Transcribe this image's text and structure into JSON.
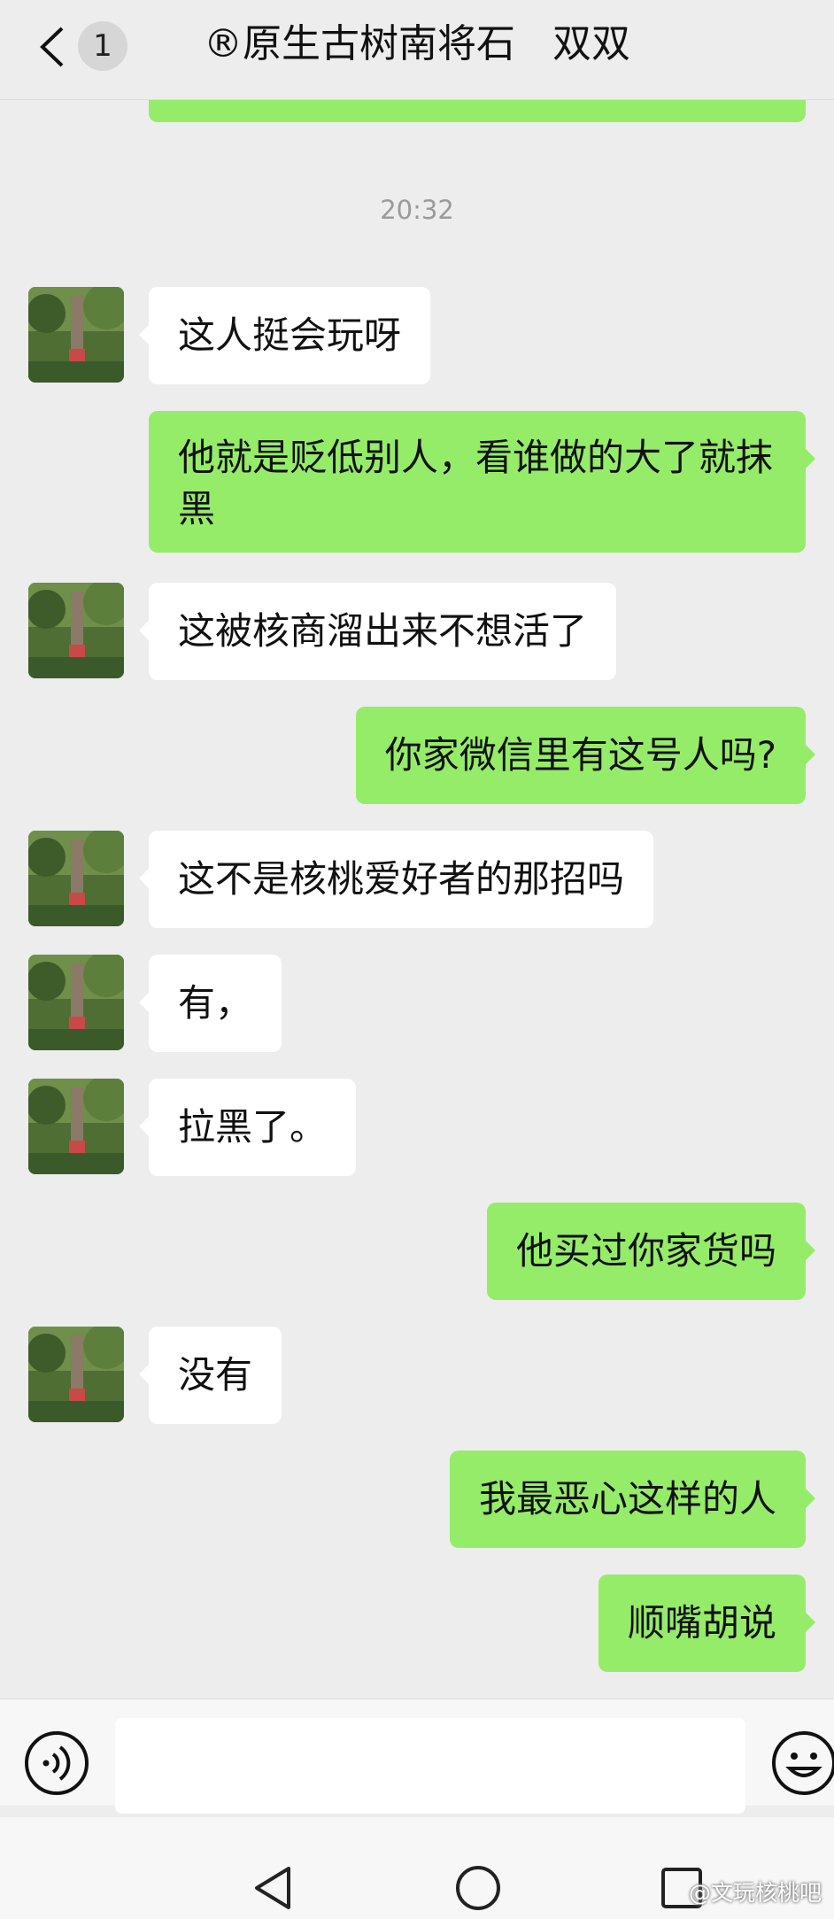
{
  "header": {
    "unread_count": "1",
    "title": "®原生古树南将石   双双"
  },
  "time_label": "20:32",
  "messages": [
    {
      "side": "in",
      "text": "这人挺会玩呀"
    },
    {
      "side": "out",
      "text": "他就是贬低别人，看谁做的大了就抹黑"
    },
    {
      "side": "in",
      "text": "这被核商溜出来不想活了"
    },
    {
      "side": "out",
      "text": "你家微信里有这号人吗?"
    },
    {
      "side": "in",
      "text": "这不是核桃爱好者的那招吗"
    },
    {
      "side": "in",
      "text": "有，"
    },
    {
      "side": "in",
      "text": "拉黑了。"
    },
    {
      "side": "out",
      "text": "他买过你家货吗"
    },
    {
      "side": "in",
      "text": "没有"
    },
    {
      "side": "out",
      "text": "我最恶心这样的人"
    },
    {
      "side": "out",
      "text": "顺嘴胡说"
    }
  ],
  "input": {
    "value": "",
    "voice_icon": "voice-icon",
    "emoji_icon": "emoji-icon"
  },
  "nav": {
    "icons": [
      "back-triangle-icon",
      "home-circle-icon",
      "recent-square-icon"
    ]
  },
  "watermark": "@文玩核桃吧",
  "colors": {
    "background": "#ededed",
    "outgoing_bubble": "#95ec69",
    "incoming_bubble": "#ffffff"
  }
}
